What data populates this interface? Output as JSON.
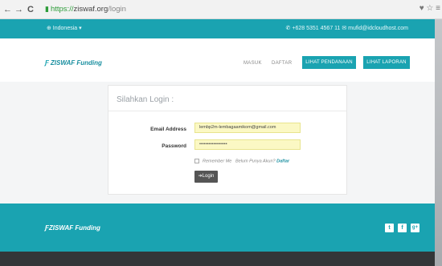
{
  "browser": {
    "url_scheme": "https://",
    "url_domain": "ziswaf.org",
    "url_path": "/login",
    "back_glyph": "←",
    "forward_glyph": "→",
    "reload_glyph": "C",
    "right_glyphs": "♥ ☆ ≡"
  },
  "topbar": {
    "language": "⊕ Indonesia ▾",
    "contact": "✆ +628 5351 4567 11  ✉ mufid@idcloudhost.com"
  },
  "header": {
    "logo_text": "ZISWAF Funding",
    "nav": {
      "masuk": "MASUK",
      "daftar": "DAFTAR",
      "lihat_pendanaan": "LIHAT PENDANAAN",
      "lihat_laporan": "LIHAT LAPORAN"
    }
  },
  "login": {
    "title": "Silahkan Login :",
    "email_label": "Email Address",
    "email_value": "lembp2m-lembagaamikom@gmail.com",
    "password_label": "Password",
    "password_value": "••••••••••••••••••",
    "remember_label": "Remember Me",
    "no_account_text": "Belum Punya Akun?",
    "register_link": "Daftar",
    "login_button": "➔Login"
  },
  "footer": {
    "logo_text": "ZISWAF Funding",
    "social": [
      "t",
      "f",
      "g+"
    ]
  },
  "colors": {
    "teal": "#1aa3b1",
    "field_bg": "#fbf8c4",
    "button_dark": "#555555"
  }
}
